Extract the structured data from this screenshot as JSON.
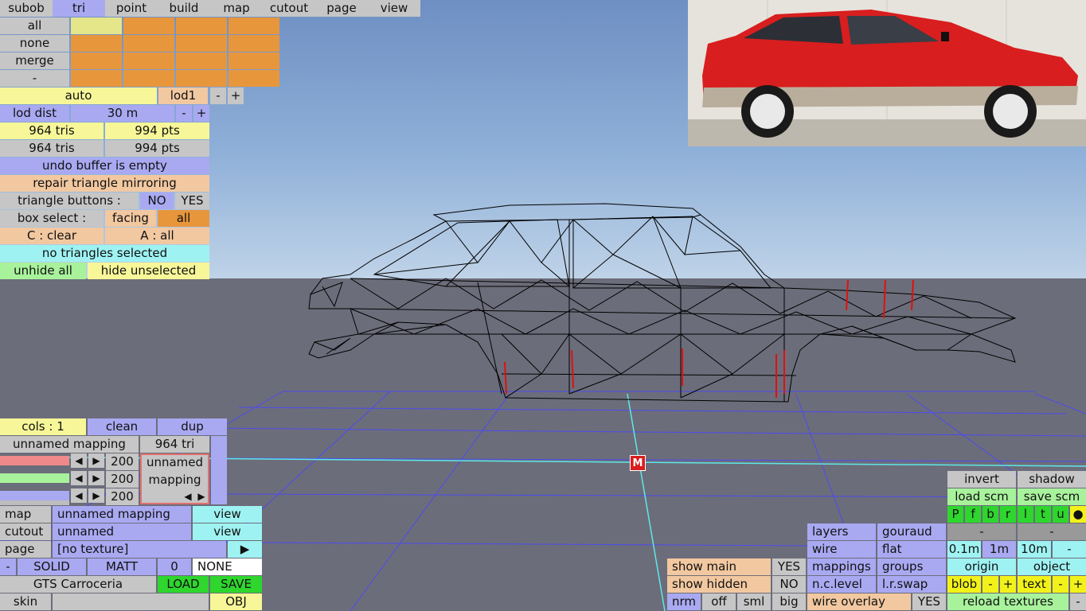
{
  "menu": [
    "subob",
    "tri",
    "point",
    "build",
    "map",
    "cutout",
    "page",
    "view"
  ],
  "select_rows": [
    "all",
    "none",
    "merge",
    "-"
  ],
  "lod": {
    "auto": "auto",
    "level": "lod1",
    "minus": "-",
    "plus": "+",
    "dist_label": "lod dist",
    "dist_value": "30 m"
  },
  "stats": [
    {
      "tris": "964 tris",
      "pts": "994 pts"
    },
    {
      "tris": "964 tris",
      "pts": "994 pts"
    }
  ],
  "status": {
    "undo": "undo buffer is empty",
    "repair": "repair triangle mirroring",
    "tri_buttons_label": "triangle buttons :",
    "no": "NO",
    "yes": "YES",
    "box_select_label": "box select :",
    "facing": "facing",
    "all": "all",
    "clear": "C : clear",
    "a_all": "A : all",
    "none_selected": "no triangles selected",
    "unhide_all": "unhide all",
    "hide_unselected": "hide unselected"
  },
  "marker": "M",
  "mapping": {
    "cols": "cols : 1",
    "clean": "clean",
    "dup": "dup",
    "name": "unnamed mapping",
    "tri_count": "964 tri",
    "values": [
      "200",
      "200",
      "200"
    ],
    "box_line1": "unnamed",
    "box_line2": "mapping",
    "prev": "◀",
    "next": "▶"
  },
  "props": {
    "map_label": "map",
    "map_value": "unnamed mapping",
    "map_view": "view",
    "cutout_label": "cutout",
    "cutout_value": "unnamed",
    "cutout_view": "view",
    "page_label": "page",
    "page_value": "[no texture]",
    "page_arrow": "▶",
    "minus": "-",
    "solid": "SOLID",
    "matt": "MATT",
    "zero": "0",
    "none": "NONE",
    "object_name": "GTS Carroceria",
    "load": "LOAD",
    "save": "SAVE",
    "skin": "skin",
    "obj": "OBJ"
  },
  "show": {
    "main": "show main",
    "main_val": "YES",
    "hidden": "show hidden",
    "hidden_val": "NO",
    "nrm": "nrm",
    "off": "off",
    "sml": "sml",
    "big": "big"
  },
  "render": {
    "layers": "layers",
    "gouraud": "gouraud",
    "wire": "wire",
    "flat": "flat",
    "mappings": "mappings",
    "groups": "groups",
    "nclevel": "n.c.level",
    "lrswap": "l.r.swap",
    "wire_overlay": "wire overlay",
    "wire_overlay_val": "YES"
  },
  "right": {
    "invert": "invert",
    "shadow": "shadow",
    "load_scm": "load scm",
    "save_scm": "save scm",
    "letters": [
      "P",
      "f",
      "b",
      "r",
      "l",
      "t",
      "u",
      "●"
    ],
    "dash1": "-",
    "dash2": "-",
    "g01": "0.1m",
    "g1": "1m",
    "g10": "10m",
    "gminus": "-",
    "origin": "origin",
    "object": "object",
    "blob": "blob",
    "text": "text",
    "minus": "-",
    "plus": "+",
    "reload": "reload textures"
  },
  "colors": {
    "sky": "#7f9fcf",
    "ground": "#6c6d7a",
    "grid": "#4a4af0",
    "axis": "#5de8e8",
    "wire": "#000000",
    "seam": "#e01010",
    "car": "#d81e1e"
  }
}
